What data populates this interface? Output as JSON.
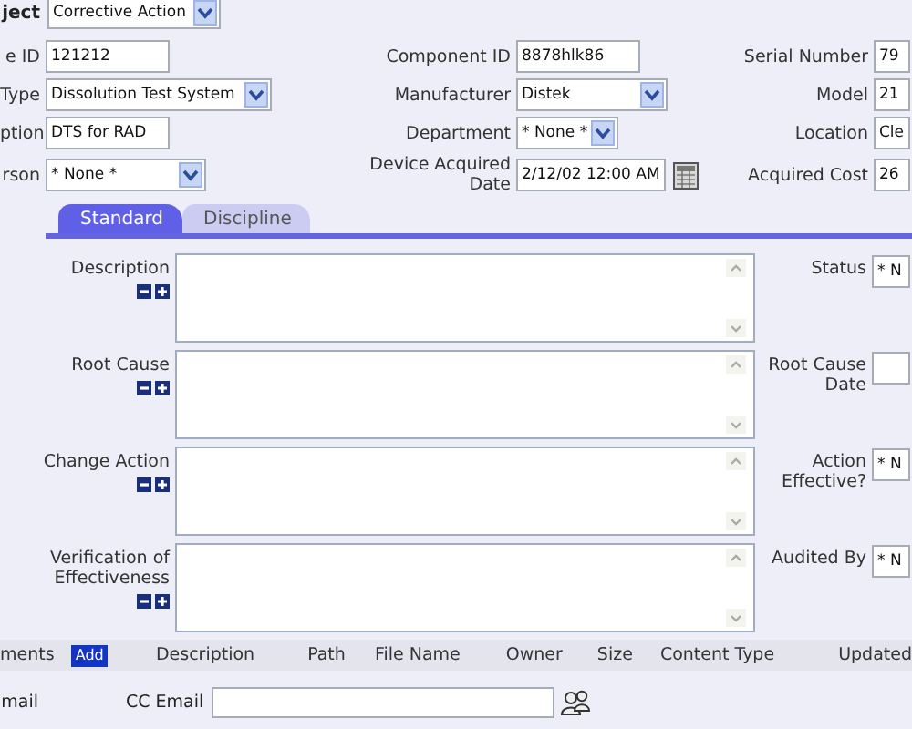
{
  "header": {
    "label": "ject",
    "value": "Corrective Action"
  },
  "fields": [
    {
      "label": "e ID",
      "kind": "text",
      "value": "121212"
    },
    {
      "label": "Component ID",
      "kind": "text",
      "value": "8878hlk86"
    },
    {
      "label": "Serial Number",
      "kind": "text",
      "value": "79"
    },
    {
      "label": "Type",
      "kind": "select",
      "value": "Dissolution Test System"
    },
    {
      "label": "Manufacturer",
      "kind": "select",
      "value": "Distek"
    },
    {
      "label": "Model",
      "kind": "text",
      "value": "21"
    },
    {
      "label": "ption",
      "kind": "text",
      "value": "DTS for RAD"
    },
    {
      "label": "Department",
      "kind": "select",
      "value": "* None *"
    },
    {
      "label": "Location",
      "kind": "text",
      "value": "Cle"
    },
    {
      "label": "rson",
      "kind": "select",
      "value": "* None *"
    },
    {
      "label": "Device Acquired Date",
      "kind": "date",
      "value": "2/12/02 12:00 AM"
    },
    {
      "label": "Acquired Cost",
      "kind": "text",
      "value": "26"
    }
  ],
  "tabs": [
    {
      "label": "Standard",
      "selected": true
    },
    {
      "label": "Discipline",
      "selected": false
    }
  ],
  "memos": [
    {
      "label": "Description",
      "side": {
        "label": "Status",
        "value": "* N"
      }
    },
    {
      "label": "Root Cause",
      "side": {
        "label": "Root Cause Date"
      }
    },
    {
      "label": "Change Action",
      "side": {
        "label": "Action Effective?",
        "value": "* N"
      }
    },
    {
      "label": "Verification of Effectiveness",
      "side": {
        "label": "Audited By",
        "value": "* N"
      }
    }
  ],
  "attachments": {
    "label": "ments",
    "add_button": "Add",
    "columns": [
      "Description",
      "Path",
      "File Name",
      "Owner",
      "Size",
      "Content Type",
      "Updated"
    ]
  },
  "email": {
    "label": "mail",
    "cc_label": "CC Email"
  }
}
